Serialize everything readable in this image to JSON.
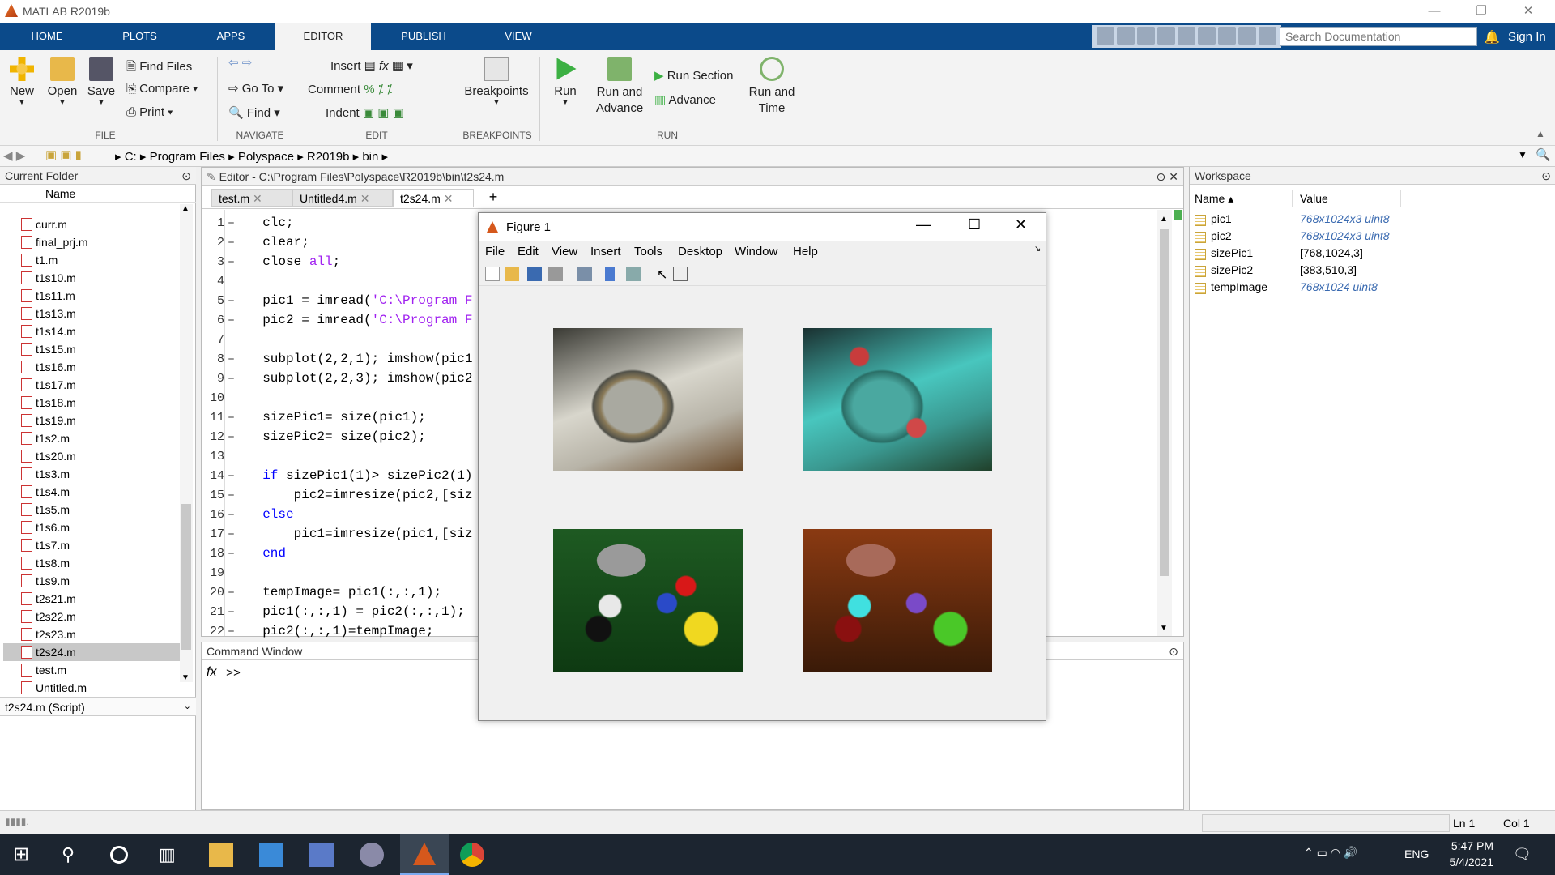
{
  "app": {
    "title": "MATLAB R2019b"
  },
  "ribbon_tabs": [
    "HOME",
    "PLOTS",
    "APPS",
    "EDITOR",
    "PUBLISH",
    "VIEW"
  ],
  "search": {
    "placeholder": "Search Documentation"
  },
  "signin": "Sign In",
  "ribbon": {
    "file": {
      "new": "New",
      "open": "Open",
      "save": "Save",
      "find_files": "Find Files",
      "compare": "Compare",
      "print": "Print",
      "group": "FILE"
    },
    "navigate": {
      "go_to": "Go To",
      "find": "Find",
      "group": "NAVIGATE"
    },
    "edit": {
      "insert": "Insert",
      "comment": "Comment",
      "indent": "Indent",
      "group": "EDIT"
    },
    "breakpoints": {
      "label": "Breakpoints",
      "group": "BREAKPOINTS"
    },
    "run": {
      "run": "Run",
      "run_advance": "Run and Advance",
      "run_section": "Run Section",
      "advance": "Advance",
      "run_time": "Run and Time",
      "group": "RUN"
    }
  },
  "address": [
    "C:",
    "Program Files",
    "Polyspace",
    "R2019b",
    "bin"
  ],
  "current_folder": {
    "title": "Current Folder",
    "column": "Name",
    "files": [
      "curr.m",
      "final_prj.m",
      "t1.m",
      "t1s10.m",
      "t1s11.m",
      "t1s13.m",
      "t1s14.m",
      "t1s15.m",
      "t1s16.m",
      "t1s17.m",
      "t1s18.m",
      "t1s19.m",
      "t1s2.m",
      "t1s20.m",
      "t1s3.m",
      "t1s4.m",
      "t1s5.m",
      "t1s6.m",
      "t1s7.m",
      "t1s8.m",
      "t1s9.m",
      "t2s21.m",
      "t2s22.m",
      "t2s23.m",
      "t2s24.m",
      "test.m",
      "Untitled.m"
    ],
    "selected": "t2s24.m",
    "details": "t2s24.m  (Script)"
  },
  "editor": {
    "title": "Editor - C:\\Program Files\\Polyspace\\R2019b\\bin\\t2s24.m",
    "tabs": [
      "test.m",
      "Untitled4.m",
      "t2s24.m"
    ],
    "active_tab": "t2s24.m",
    "lines": [
      {
        "n": "1",
        "dash": true,
        "code": "  clc;"
      },
      {
        "n": "2",
        "dash": true,
        "code": "  clear;"
      },
      {
        "n": "3",
        "dash": true,
        "code": "  close all;"
      },
      {
        "n": "4",
        "dash": false,
        "code": ""
      },
      {
        "n": "5",
        "dash": true,
        "code": "  pic1 = imread('C:\\Program F"
      },
      {
        "n": "6",
        "dash": true,
        "code": "  pic2 = imread('C:\\Program F"
      },
      {
        "n": "7",
        "dash": false,
        "code": ""
      },
      {
        "n": "8",
        "dash": true,
        "code": "  subplot(2,2,1); imshow(pic1"
      },
      {
        "n": "9",
        "dash": true,
        "code": "  subplot(2,2,3); imshow(pic2"
      },
      {
        "n": "10",
        "dash": false,
        "code": ""
      },
      {
        "n": "11",
        "dash": true,
        "code": "  sizePic1= size(pic1);"
      },
      {
        "n": "12",
        "dash": true,
        "code": "  sizePic2= size(pic2);"
      },
      {
        "n": "13",
        "dash": false,
        "code": ""
      },
      {
        "n": "14",
        "dash": true,
        "code": "  if sizePic1(1)> sizePic2(1)"
      },
      {
        "n": "15",
        "dash": true,
        "code": "      pic2=imresize(pic2,[siz"
      },
      {
        "n": "16",
        "dash": true,
        "code": "  else"
      },
      {
        "n": "17",
        "dash": true,
        "code": "      pic1=imresize(pic1,[siz"
      },
      {
        "n": "18",
        "dash": true,
        "code": "  end"
      },
      {
        "n": "19",
        "dash": false,
        "code": ""
      },
      {
        "n": "20",
        "dash": true,
        "code": "  tempImage= pic1(:,:,1);"
      },
      {
        "n": "21",
        "dash": true,
        "code": "  pic1(:,:,1) = pic2(:,:,1);"
      },
      {
        "n": "22",
        "dash": true,
        "code": "  pic2(:,:,1)=tempImage;"
      }
    ]
  },
  "command_window": {
    "title": "Command Window",
    "prompt": ">>"
  },
  "workspace": {
    "title": "Workspace",
    "columns": [
      "Name",
      "Value"
    ],
    "vars": [
      {
        "name": "pic1",
        "value": "768x1024x3 uint8"
      },
      {
        "name": "pic2",
        "value": "768x1024x3 uint8"
      },
      {
        "name": "sizePic1",
        "value": "[768,1024,3]"
      },
      {
        "name": "sizePic2",
        "value": "[383,510,3]"
      },
      {
        "name": "tempImage",
        "value": "768x1024 uint8"
      }
    ]
  },
  "figure": {
    "title": "Figure 1",
    "menu": [
      "File",
      "Edit",
      "View",
      "Insert",
      "Tools",
      "Desktop",
      "Window",
      "Help"
    ]
  },
  "status": {
    "ln": "Ln  1",
    "col": "Col  1"
  },
  "taskbar": {
    "lang": "ENG",
    "time": "5:47 PM",
    "date": "5/4/2021"
  }
}
